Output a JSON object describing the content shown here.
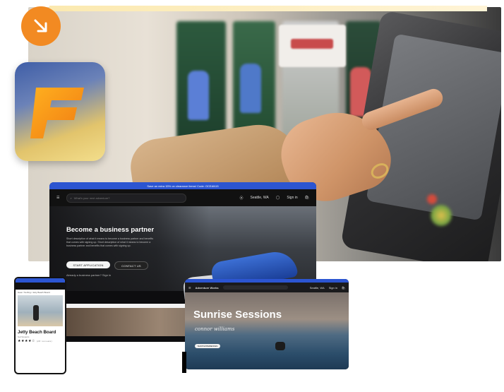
{
  "laptop": {
    "promo": "Save an extra 15% on clearance items! Code: OCEAN15",
    "search_placeholder": "What's your next adventure?",
    "location": "Seattle, WA",
    "signin": "Sign in",
    "hero_title": "Become a business partner",
    "hero_desc": "Short description of what it means to become a business partner and benefits that comes with signing up. Short description of what it means to become a business partner and benefits that comes with signing up.",
    "primary_button": "START APPLICATION",
    "secondary_button": "CONTACT US",
    "partner_text": "Already a business partner? Sign in"
  },
  "phone": {
    "breadcrumb": "Gear / Surfing / Jetty Beach Board",
    "product_title": "Jetty Beach Board",
    "brand": "Surf Experts",
    "rating_stars": "★★★★☆",
    "review_count": "(28 reviews)"
  },
  "tablet": {
    "brand": "Adventure Works",
    "location": "Seattle, WA",
    "signin": "Sign in",
    "hero_title": "Sunrise Sessions",
    "signature": "connor williams",
    "button": "SHOP EXPERIENCES"
  },
  "icons": {
    "arrow_badge": "arrow-down-right-icon",
    "app": "app-logo-icon"
  },
  "colors": {
    "accent_orange": "#f28a22",
    "promo_blue": "#2c55d1"
  }
}
